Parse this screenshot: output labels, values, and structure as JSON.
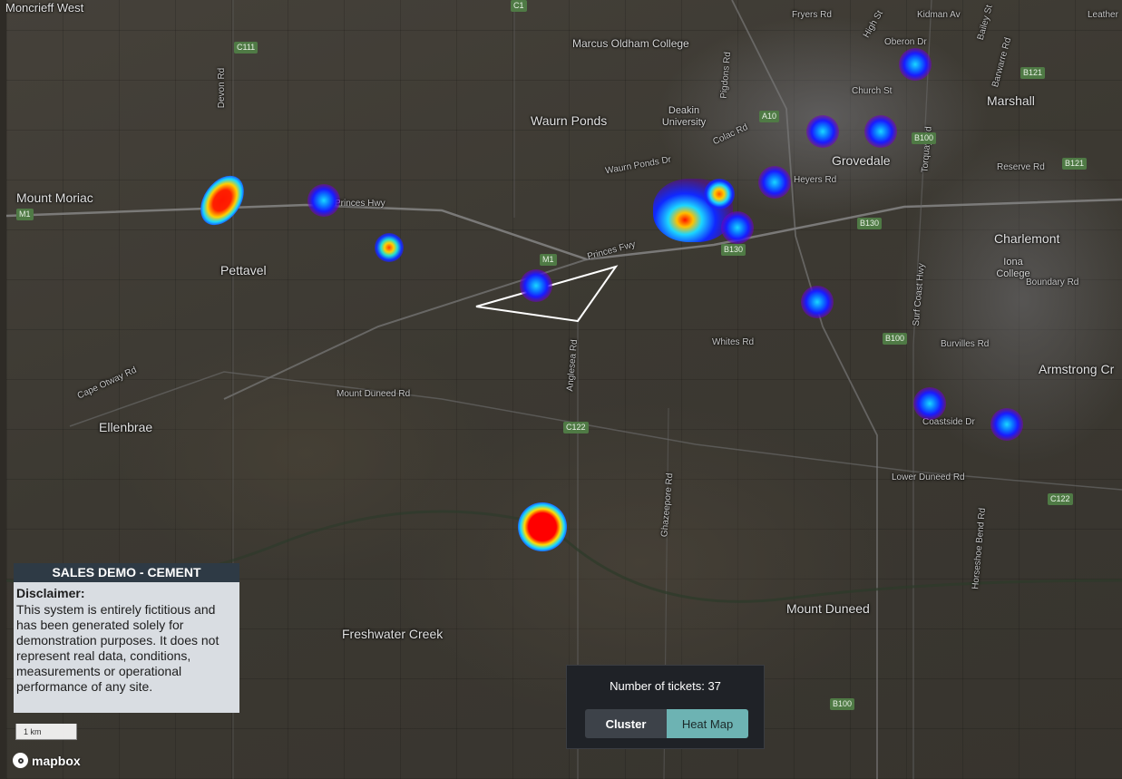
{
  "map": {
    "places": [
      {
        "name": "Moncrieff West"
      },
      {
        "name": "Marcus Oldham College"
      },
      {
        "name": "Waurn Ponds"
      },
      {
        "name": "Deakin University"
      },
      {
        "name": "Mount Moriac"
      },
      {
        "name": "Pettavel"
      },
      {
        "name": "Grovedale"
      },
      {
        "name": "Marshall"
      },
      {
        "name": "Charlemont"
      },
      {
        "name": "Iona College"
      },
      {
        "name": "Armstrong Cr"
      },
      {
        "name": "Ellenbrae"
      },
      {
        "name": "Freshwater Creek"
      },
      {
        "name": "Mount Duneed"
      }
    ],
    "roads": [
      "Devon Rd",
      "Princes Hwy",
      "Princes Fwy",
      "Waurn Ponds Dr",
      "Colac Rd",
      "Pigdons Rd",
      "Fryers Rd",
      "High St",
      "Kidman Av",
      "Oberon Dr",
      "Church St",
      "Barwarre Rd",
      "Bailey St",
      "Reserve Rd",
      "Heyers Rd",
      "Torquay Rd",
      "Boundary Rd",
      "Burvilles Rd",
      "Whites Rd",
      "Surf Coast Hwy",
      "Mount Duneed Rd",
      "Cape Otway Rd",
      "Anglesea Rd",
      "Ghazeepore Rd",
      "Coastside Dr",
      "Lower Duneed Rd",
      "Horseshoe Bend Rd",
      "Leather"
    ],
    "shields": [
      "C111",
      "M1",
      "M1",
      "A10",
      "B100",
      "B121",
      "B121",
      "B130",
      "B130",
      "B100",
      "C122",
      "C122",
      "B100",
      "C1"
    ],
    "hotspot_count": 17
  },
  "disclaimer": {
    "title": "SALES DEMO - CEMENT",
    "heading": "Disclaimer:",
    "text": "This system is entirely fictitious and has been generated solely for demonstration purposes. It does not represent real data, conditions, measurements or operational performance of any site."
  },
  "scale": {
    "label": "1 km"
  },
  "attribution": {
    "logo_text": "mapbox",
    "icon": "mapbox-logo-icon"
  },
  "tickets": {
    "count_text": "Number of tickets: 37",
    "cluster_label": "Cluster",
    "heatmap_label": "Heat Map",
    "active_view": "Heat Map"
  },
  "colors": {
    "panel_bg": "#1f2227",
    "cluster_btn": "#3d4249",
    "heatmap_btn": "#6db3b3",
    "disclaimer_header": "#2e3a45",
    "disclaimer_bg": "#d9dde2"
  }
}
